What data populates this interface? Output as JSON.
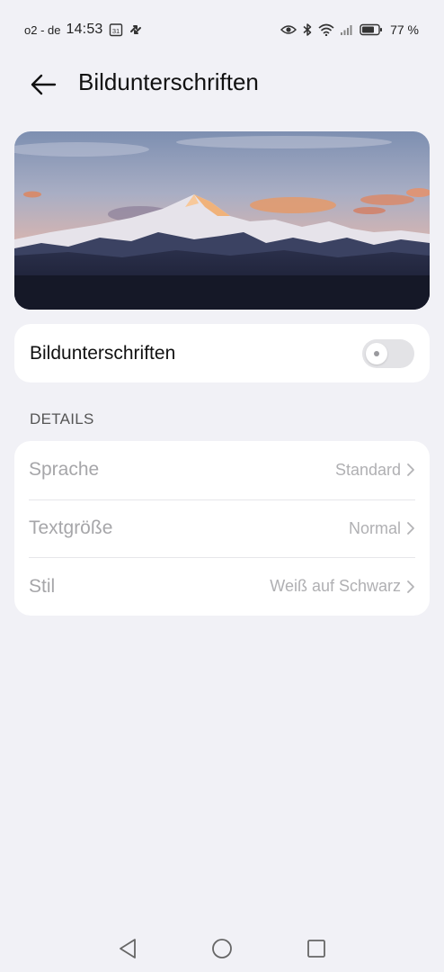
{
  "status_bar": {
    "carrier": "o2 - de",
    "time": "14:53",
    "calendar_day": "31",
    "battery_percent": "77 %",
    "icons": [
      "calendar-icon",
      "signal-arrows-icon",
      "eye-icon",
      "bluetooth-icon",
      "wifi-icon",
      "cell-signal-icon",
      "battery-icon"
    ]
  },
  "header": {
    "title": "Bildunterschriften",
    "back_icon": "arrow-left-icon"
  },
  "banner": {
    "description": "mountain-sunset-image"
  },
  "captions_toggle": {
    "label": "Bildunterschriften",
    "enabled": false
  },
  "details": {
    "section_title": "DETAILS",
    "rows": [
      {
        "label": "Sprache",
        "value": "Standard"
      },
      {
        "label": "Textgröße",
        "value": "Normal"
      },
      {
        "label": "Stil",
        "value": "Weiß auf Schwarz"
      }
    ]
  },
  "nav": {
    "icons": [
      "back-triangle-icon",
      "home-circle-icon",
      "recents-square-icon"
    ]
  },
  "colors": {
    "background": "#f1f1f6",
    "card": "#ffffff",
    "disabled_text": "#a6a6a9",
    "switch_off": "#e3e3e6"
  }
}
